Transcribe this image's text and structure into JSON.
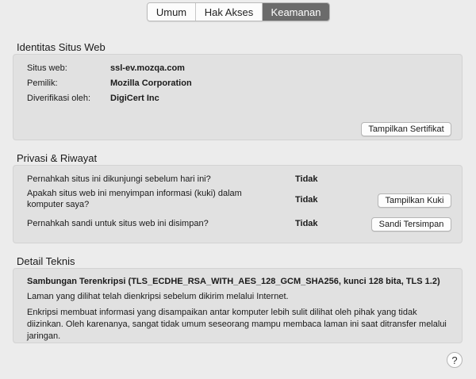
{
  "tabs": [
    {
      "label": "Umum"
    },
    {
      "label": "Hak Akses"
    },
    {
      "label": "Keamanan"
    }
  ],
  "identity": {
    "title": "Identitas Situs Web",
    "site_label": "Situs web:",
    "site_value": "ssl-ev.mozqa.com",
    "owner_label": "Pemilik:",
    "owner_value": "Mozilla Corporation",
    "verified_label": "Diverifikasi oleh:",
    "verified_value": "DigiCert Inc",
    "view_cert_button": "Tampilkan Sertifikat"
  },
  "privacy": {
    "title": "Privasi & Riwayat",
    "q1": "Pernahkah situs ini dikunjungi sebelum hari ini?",
    "a1": "Tidak",
    "q2_line1": "Apakah situs web ini menyimpan informasi (kuki) dalam",
    "q2_line2": "komputer saya?",
    "a2": "Tidak",
    "view_cookies_button": "Tampilkan Kuki",
    "q3": "Pernahkah sandi untuk situs web ini disimpan?",
    "a3": "Tidak",
    "saved_passwords_button": "Sandi Tersimpan"
  },
  "technical": {
    "title": "Detail Teknis",
    "connection": "Sambungan Terenkripsi (TLS_ECDHE_RSA_WITH_AES_128_GCM_SHA256, kunci 128 bita, TLS 1.2)",
    "line1": "Laman yang dilihat telah dienkripsi sebelum dikirim melalui Internet.",
    "line2": "Enkripsi membuat informasi yang disampaikan antar komputer lebih sulit dilihat oleh pihak yang tidak diizinkan. Oleh karenanya, sangat tidak umum seseorang mampu membaca laman ini saat ditransfer melalui jaringan."
  },
  "help": {
    "glyph": "?"
  }
}
